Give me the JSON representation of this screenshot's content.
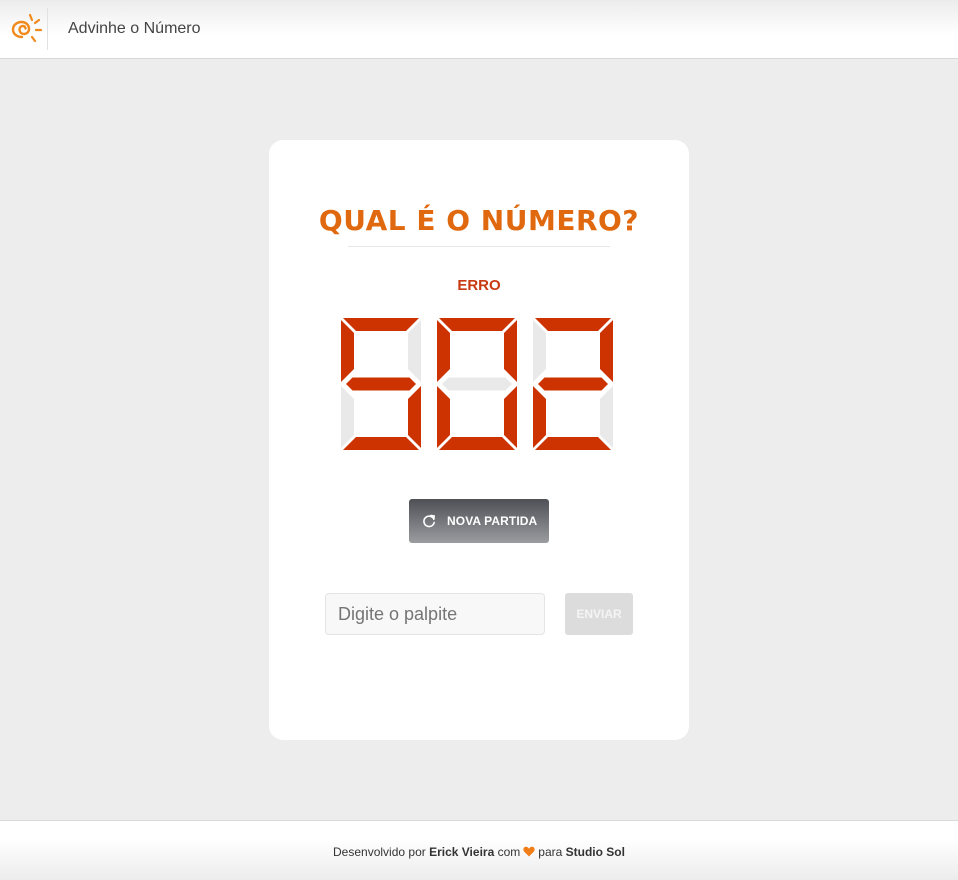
{
  "header": {
    "logo_icon": "sun-spiral-icon",
    "app_title": "Advinhe o Número"
  },
  "game": {
    "title": "QUAL É O NÚMERO?",
    "status": "ERRO",
    "display_value": "502",
    "display_on_color": "#cc3300",
    "display_off_color": "#e9e9e9",
    "new_game_label": "NOVA PARTIDA",
    "new_game_icon": "refresh-icon",
    "guess_placeholder": "Digite o palpite",
    "guess_value": "",
    "send_label": "ENVIAR"
  },
  "footer": {
    "prefix": "Desenvolvido por",
    "author": "Erick Vieira",
    "middle": "com",
    "heart_icon": "heart-icon",
    "for_text": "para",
    "company": "Studio Sol"
  },
  "colors": {
    "accent": "#e0690f",
    "error": "#c93a12"
  }
}
